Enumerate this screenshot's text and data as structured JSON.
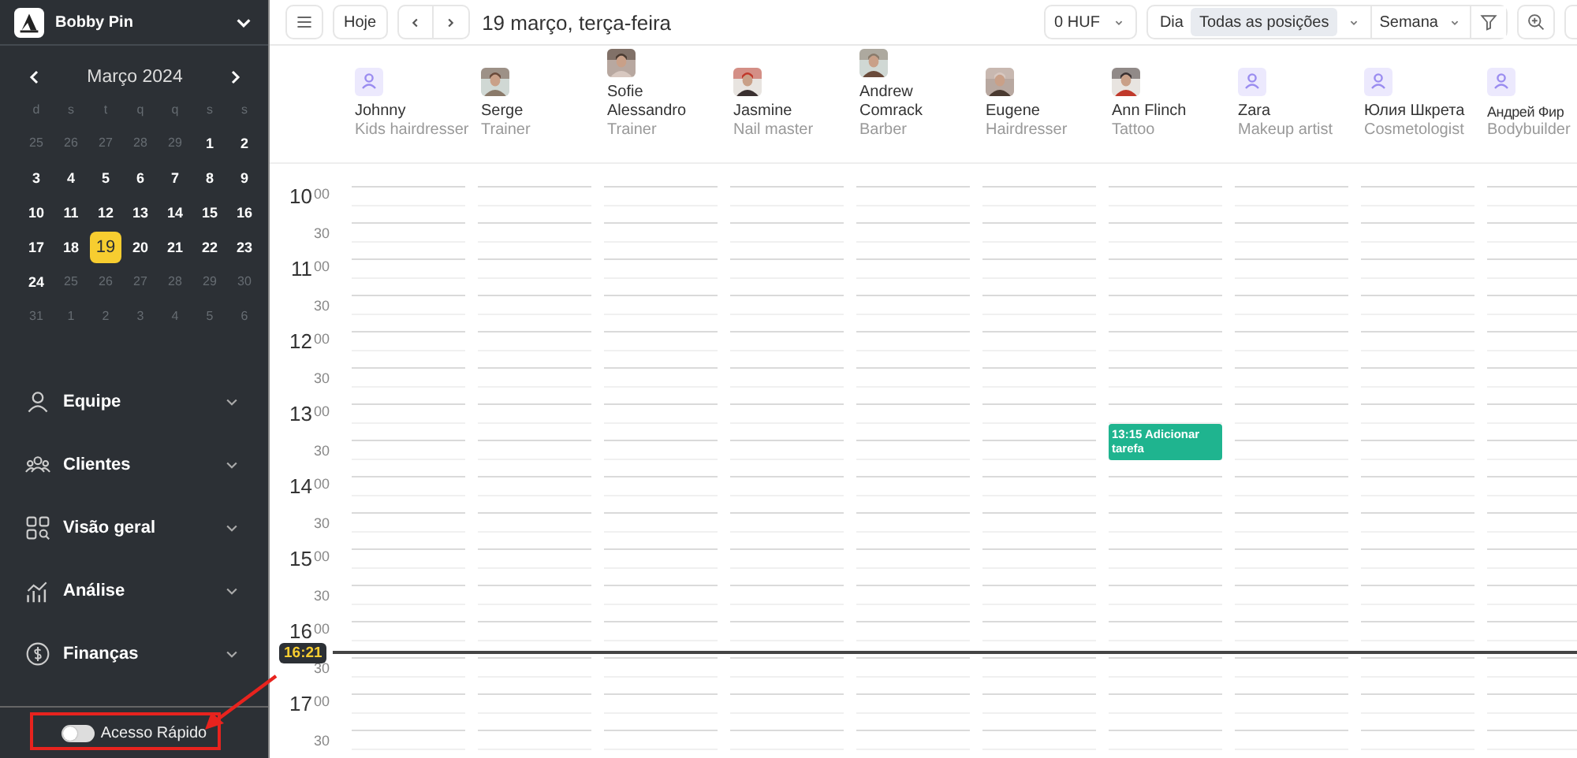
{
  "sidebar": {
    "business": "Bobby Pin",
    "calendar": {
      "month": "Março 2024",
      "weekdays": [
        "d",
        "s",
        "t",
        "q",
        "q",
        "s",
        "s"
      ],
      "days": [
        {
          "label": "25",
          "muted": true,
          "selected": false
        },
        {
          "label": "26",
          "muted": true,
          "selected": false
        },
        {
          "label": "27",
          "muted": true,
          "selected": false
        },
        {
          "label": "28",
          "muted": true,
          "selected": false
        },
        {
          "label": "29",
          "muted": true,
          "selected": false
        },
        {
          "label": "1",
          "muted": false,
          "selected": false
        },
        {
          "label": "2",
          "muted": false,
          "selected": false
        },
        {
          "label": "3",
          "muted": false,
          "selected": false
        },
        {
          "label": "4",
          "muted": false,
          "selected": false
        },
        {
          "label": "5",
          "muted": false,
          "selected": false
        },
        {
          "label": "6",
          "muted": false,
          "selected": false
        },
        {
          "label": "7",
          "muted": false,
          "selected": false
        },
        {
          "label": "8",
          "muted": false,
          "selected": false
        },
        {
          "label": "9",
          "muted": false,
          "selected": false
        },
        {
          "label": "10",
          "muted": false,
          "selected": false
        },
        {
          "label": "11",
          "muted": false,
          "selected": false
        },
        {
          "label": "12",
          "muted": false,
          "selected": false
        },
        {
          "label": "13",
          "muted": false,
          "selected": false
        },
        {
          "label": "14",
          "muted": false,
          "selected": false
        },
        {
          "label": "15",
          "muted": false,
          "selected": false
        },
        {
          "label": "16",
          "muted": false,
          "selected": false
        },
        {
          "label": "17",
          "muted": false,
          "selected": false
        },
        {
          "label": "18",
          "muted": false,
          "selected": false
        },
        {
          "label": "19",
          "muted": false,
          "selected": true
        },
        {
          "label": "20",
          "muted": false,
          "selected": false
        },
        {
          "label": "21",
          "muted": false,
          "selected": false
        },
        {
          "label": "22",
          "muted": false,
          "selected": false
        },
        {
          "label": "23",
          "muted": false,
          "selected": false
        },
        {
          "label": "24",
          "muted": false,
          "selected": false
        },
        {
          "label": "25",
          "muted": true,
          "selected": false
        },
        {
          "label": "26",
          "muted": true,
          "selected": false
        },
        {
          "label": "27",
          "muted": true,
          "selected": false
        },
        {
          "label": "28",
          "muted": true,
          "selected": false
        },
        {
          "label": "29",
          "muted": true,
          "selected": false
        },
        {
          "label": "30",
          "muted": true,
          "selected": false
        },
        {
          "label": "31",
          "muted": true,
          "selected": false
        },
        {
          "label": "1",
          "muted": true,
          "selected": false
        },
        {
          "label": "2",
          "muted": true,
          "selected": false
        },
        {
          "label": "3",
          "muted": true,
          "selected": false
        },
        {
          "label": "4",
          "muted": true,
          "selected": false
        },
        {
          "label": "5",
          "muted": true,
          "selected": false
        },
        {
          "label": "6",
          "muted": true,
          "selected": false
        }
      ]
    },
    "nav": [
      {
        "kind": "person",
        "label": "Equipe"
      },
      {
        "kind": "group",
        "label": "Clientes"
      },
      {
        "kind": "grid",
        "label": "Visão geral"
      },
      {
        "kind": "chart",
        "label": "Análise"
      },
      {
        "kind": "money",
        "label": "Finanças"
      }
    ],
    "quick_access": {
      "label": "Acesso Rápido",
      "on": false
    }
  },
  "toolbar": {
    "today": "Hoje",
    "date": "19 março, terça-feira",
    "currency": "0 HUF",
    "segments": [
      {
        "label": "Dia",
        "selected": false
      },
      {
        "label": "Todas as posições",
        "selected": true
      }
    ],
    "range": "Semana"
  },
  "staff": [
    {
      "name": "Johnny",
      "role": "Kids hairdresser",
      "kind": "placeholder"
    },
    {
      "name": "Serge",
      "role": "Trainer"
    },
    {
      "name": "Sofie Alessandro",
      "role": "Trainer"
    },
    {
      "name": "Jasmine",
      "role": "Nail master"
    },
    {
      "name": "Andrew Comrack",
      "role": "Barber"
    },
    {
      "name": "Eugene",
      "role": "Hairdresser"
    },
    {
      "name": "Ann Flinch",
      "role": "Tattoo",
      "events": [
        {
          "text": "13:15 Adicionar tarefa"
        }
      ]
    },
    {
      "name": "Zara",
      "role": "Makeup artist",
      "kind": "placeholder"
    },
    {
      "name": "Юлия Шкрета",
      "role": "Cosmetologist",
      "kind": "placeholder"
    },
    {
      "name": "Андрей Фир",
      "role": "Bodybuilder",
      "kind": "placeholder"
    }
  ],
  "times": [
    {
      "hour": "10",
      "minute": "00"
    },
    {
      "minute": "30"
    },
    {
      "hour": "11",
      "minute": "00"
    },
    {
      "minute": "30"
    },
    {
      "hour": "12",
      "minute": "00"
    },
    {
      "minute": "30"
    },
    {
      "hour": "13",
      "minute": "00"
    },
    {
      "minute": "30"
    },
    {
      "hour": "14",
      "minute": "00"
    },
    {
      "minute": "30"
    },
    {
      "hour": "15",
      "minute": "00"
    },
    {
      "minute": "30"
    },
    {
      "hour": "16",
      "minute": "00"
    },
    {
      "minute": "30"
    },
    {
      "hour": "17",
      "minute": "00"
    },
    {
      "minute": "30"
    }
  ],
  "now": {
    "label": "16:21"
  }
}
